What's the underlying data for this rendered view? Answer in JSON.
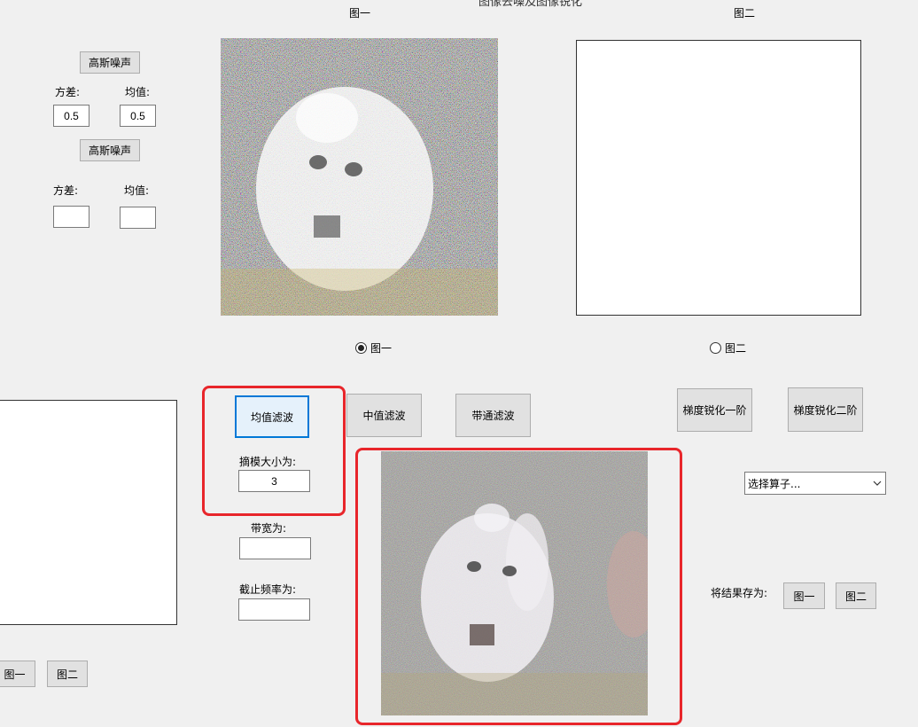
{
  "window": {
    "title_partial": "图像去噪及图像锐化"
  },
  "top": {
    "label_img1": "图一",
    "label_img2": "图二"
  },
  "noise": {
    "gauss_button_1": "高斯噪声",
    "variance_label_1": "方差:",
    "mean_label_1": "均值:",
    "variance_value_1": "0.5",
    "mean_value_1": "0.5",
    "gauss_button_2": "高斯噪声",
    "variance_label_2": "方差:",
    "mean_label_2": "均值:",
    "variance_value_2": "",
    "mean_value_2": ""
  },
  "radios": [
    {
      "label": "图一",
      "checked": true
    },
    {
      "label": "图二",
      "checked": false
    }
  ],
  "filters": {
    "mean_filter": "均值滤波",
    "median_filter": "中值滤波",
    "bandpass_filter": "带通滤波",
    "template_size_label": "摘模大小为:",
    "template_size_value": "3",
    "bandwidth_label": "带宽为:",
    "bandwidth_value": "",
    "cutoff_label": "截止频率为:",
    "cutoff_value": ""
  },
  "sharpen": {
    "first_order": "梯度锐化一阶",
    "second_order": "梯度锐化二阶",
    "operator_select": "选择算子..."
  },
  "save": {
    "label": "将结果存为:",
    "to_img1": "图一",
    "to_img2": "图二"
  },
  "bottom_left": {
    "to_img1": "图一",
    "to_img2": "图二"
  },
  "colors": {
    "highlight": "#e8262b",
    "focus": "#0078d7"
  }
}
